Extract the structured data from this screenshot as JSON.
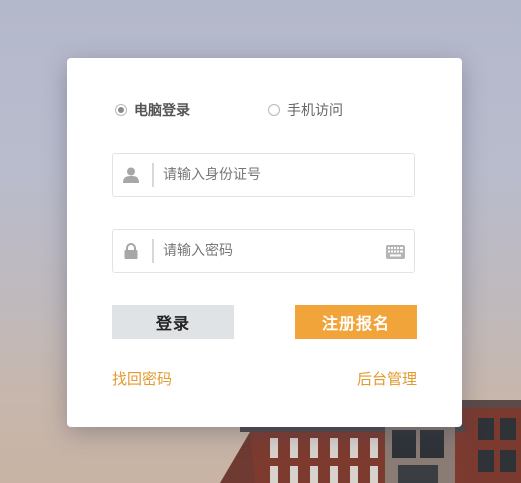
{
  "login_mode": {
    "options": [
      {
        "label": "电脑登录",
        "selected": true
      },
      {
        "label": "手机访问",
        "selected": false
      }
    ]
  },
  "id_field": {
    "placeholder": "请输入身份证号",
    "icon": "user-icon"
  },
  "password_field": {
    "placeholder": "请输入密码",
    "icon": "lock-icon",
    "trailing_icon": "keyboard-icon"
  },
  "buttons": {
    "login": "登录",
    "register": "注册报名"
  },
  "links": {
    "forgot_password": "找回密码",
    "admin": "后台管理"
  },
  "colors": {
    "accent": "#f0a43a",
    "link": "#e39a2e",
    "login_button_bg": "#dfe3e6"
  }
}
